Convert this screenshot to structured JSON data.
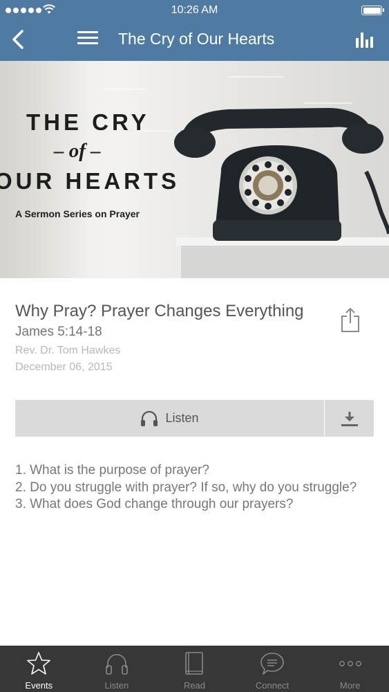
{
  "status_bar": {
    "time": "10:26 AM"
  },
  "nav": {
    "title": "The Cry of Our Hearts"
  },
  "hero": {
    "line1": "THE CRY",
    "line2": "– of –",
    "line3": "OUR HEARTS",
    "subtitle": "A Sermon Series on Prayer"
  },
  "sermon": {
    "title": "Why Pray? Prayer Changes Everything",
    "scripture": "James 5:14-18",
    "speaker": "Rev. Dr. Tom Hawkes",
    "date": "December 06, 2015"
  },
  "actions": {
    "listen_label": "Listen"
  },
  "notes": [
    "1. What is the purpose of prayer?",
    "2. Do you struggle with prayer? If so, why do you struggle?",
    "3. What does God change through our prayers?"
  ],
  "tabs": [
    {
      "label": "Events",
      "icon": "star-icon",
      "active": true
    },
    {
      "label": "Listen",
      "icon": "headphones-icon",
      "active": false
    },
    {
      "label": "Read",
      "icon": "book-icon",
      "active": false
    },
    {
      "label": "Connect",
      "icon": "chat-bubble-icon",
      "active": false
    },
    {
      "label": "More",
      "icon": "more-dots-icon",
      "active": false
    }
  ],
  "colors": {
    "nav_bar": "#4f7ba3",
    "tab_bar": "#373737",
    "button_bg": "#dadada"
  }
}
